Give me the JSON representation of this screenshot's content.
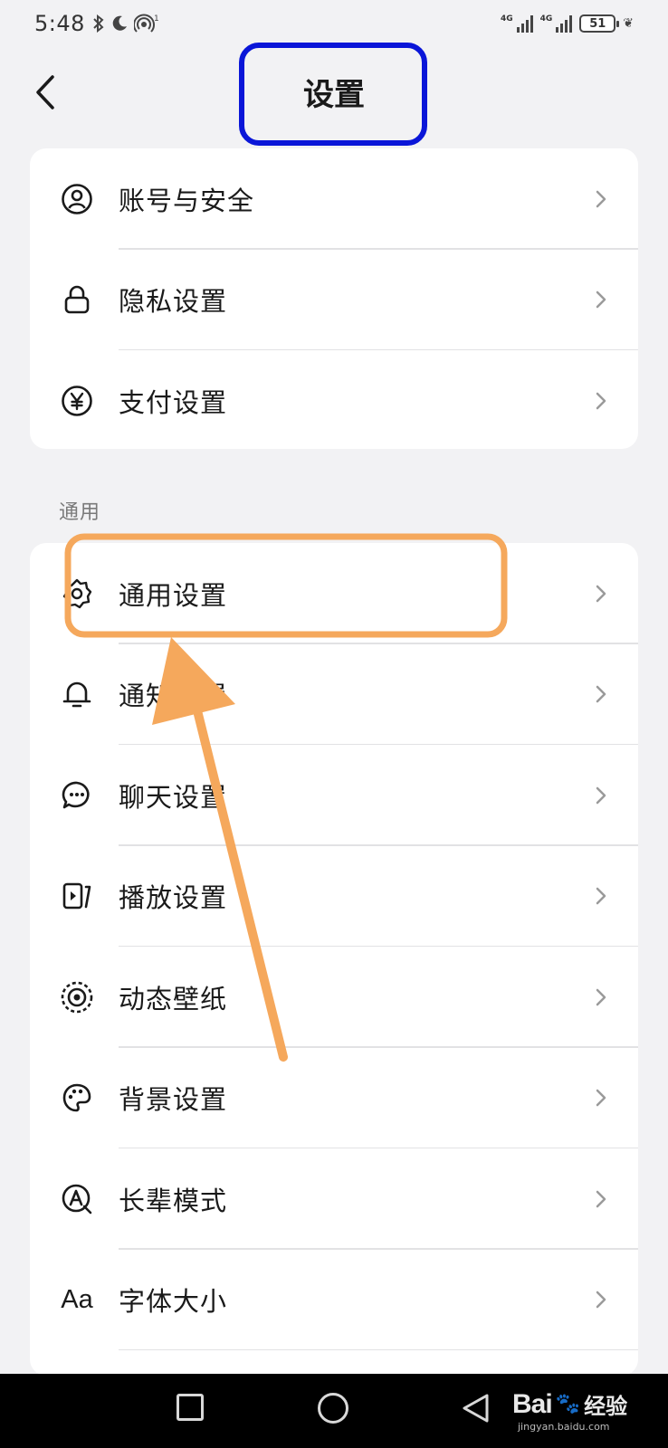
{
  "status_bar": {
    "time": "5:48",
    "network_1": "4G",
    "network_2": "4G",
    "battery": "51",
    "icons": [
      "bluetooth-icon",
      "moon-icon",
      "hotspot-icon",
      "signal-icon",
      "battery-icon"
    ]
  },
  "header": {
    "title": "设置",
    "back_icon": "chevron-left-icon"
  },
  "group_account": {
    "items": [
      {
        "label": "账号与安全",
        "icon": "user-circle-icon"
      },
      {
        "label": "隐私设置",
        "icon": "lock-icon"
      },
      {
        "label": "支付设置",
        "icon": "yuan-circle-icon"
      }
    ]
  },
  "section_general": {
    "label": "通用",
    "items": [
      {
        "label": "通用设置",
        "icon": "gear-icon"
      },
      {
        "label": "通知设置",
        "icon": "bell-icon"
      },
      {
        "label": "聊天设置",
        "icon": "chat-bubble-icon"
      },
      {
        "label": "播放设置",
        "icon": "play-screen-icon"
      },
      {
        "label": "动态壁纸",
        "icon": "dynamic-wallpaper-icon"
      },
      {
        "label": "背景设置",
        "icon": "palette-icon"
      },
      {
        "label": "长辈模式",
        "icon": "elder-mode-icon"
      },
      {
        "label": "字体大小",
        "icon_text": "Aa",
        "icon": "font-size-icon"
      }
    ]
  },
  "annotations": {
    "title_box_color": "#0a16d8",
    "highlight_color": "#f5a85c"
  },
  "watermark": {
    "logo": "Bai",
    "paw": "🐾",
    "text": "经验",
    "sub": "jingyan.baidu.com"
  }
}
